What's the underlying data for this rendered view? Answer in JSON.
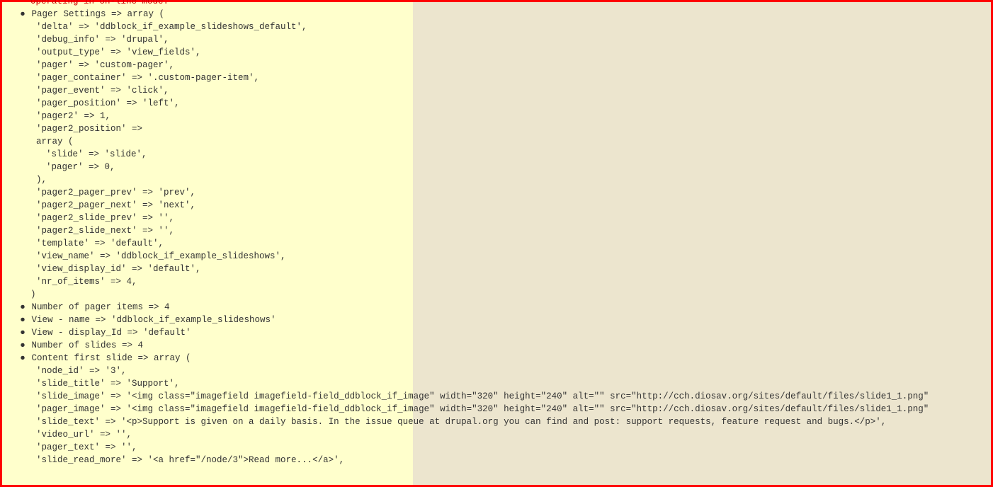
{
  "truncated_top": "Operating in on-line mode.",
  "lines": [
    {
      "type": "bullet",
      "text": "Pager Settings => array ("
    },
    {
      "type": "kv",
      "text": "'delta' => 'ddblock_if_example_slideshows_default',"
    },
    {
      "type": "kv",
      "text": "'debug_info' => 'drupal',"
    },
    {
      "type": "kv",
      "text": "'output_type' => 'view_fields',"
    },
    {
      "type": "kv",
      "text": "'pager' => 'custom-pager',"
    },
    {
      "type": "kv",
      "text": "'pager_container' => '.custom-pager-item',"
    },
    {
      "type": "kv",
      "text": "'pager_event' => 'click',"
    },
    {
      "type": "kv",
      "text": "'pager_position' => 'left',"
    },
    {
      "type": "kv",
      "text": "'pager2' => 1,"
    },
    {
      "type": "kv",
      "text": "'pager2_position' =>"
    },
    {
      "type": "kv",
      "text": "array ("
    },
    {
      "type": "kv2",
      "text": "'slide' => 'slide',"
    },
    {
      "type": "kv2",
      "text": "'pager' => 0,"
    },
    {
      "type": "kv",
      "text": "),"
    },
    {
      "type": "kv",
      "text": "'pager2_pager_prev' => 'prev',"
    },
    {
      "type": "kv",
      "text": "'pager2_pager_next' => 'next',"
    },
    {
      "type": "kv",
      "text": "'pager2_slide_prev' => '',"
    },
    {
      "type": "kv",
      "text": "'pager2_slide_next' => '',"
    },
    {
      "type": "kv",
      "text": "'template' => 'default',"
    },
    {
      "type": "kv",
      "text": "'view_name' => 'ddblock_if_example_slideshows',"
    },
    {
      "type": "kv",
      "text": "'view_display_id' => 'default',"
    },
    {
      "type": "kv",
      "text": "'nr_of_items' => 4,"
    },
    {
      "type": "close",
      "text": ")"
    },
    {
      "type": "bullet",
      "text": "Number of pager items  => 4"
    },
    {
      "type": "bullet",
      "text": "View - name => 'ddblock_if_example_slideshows'"
    },
    {
      "type": "bullet",
      "text": "View - display_Id => 'default'"
    },
    {
      "type": "bullet",
      "text": "Number of slides => 4"
    },
    {
      "type": "bullet",
      "text": "Content first slide => array ("
    },
    {
      "type": "kv",
      "text": "'node_id' => '3',"
    },
    {
      "type": "kv",
      "text": "'slide_title' => 'Support',"
    },
    {
      "type": "kv",
      "text": "'slide_image' => '<img  class=\"imagefield imagefield-field_ddblock_if_image\" width=\"320\" height=\"240\" alt=\"\" src=\"http://cch.diosav.org/sites/default/files/slide1_1.png\""
    },
    {
      "type": "kv",
      "text": "'pager_image' => '<img  class=\"imagefield imagefield-field_ddblock_if_image\" width=\"320\" height=\"240\" alt=\"\" src=\"http://cch.diosav.org/sites/default/files/slide1_1.png\""
    },
    {
      "type": "kv",
      "text": "'slide_text' => '<p>Support is given on a daily basis. In the issue queue at drupal.org you can find and post: support requests, feature request and bugs.</p>',"
    },
    {
      "type": "kv",
      "text": "'video_url' => '',"
    },
    {
      "type": "kv",
      "text": "'pager_text' => '',"
    },
    {
      "type": "kv",
      "text": "'slide_read_more' => '<a href=\"/node/3\">Read more...</a>',"
    }
  ]
}
